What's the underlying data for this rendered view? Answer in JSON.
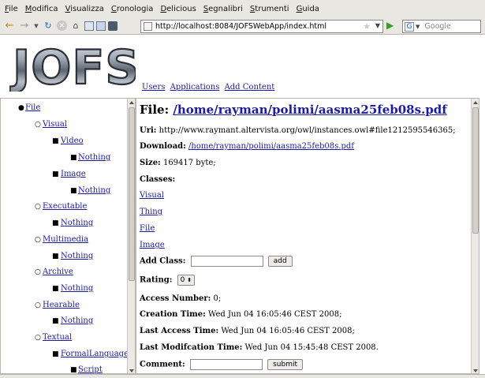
{
  "menu": [
    "File",
    "Modifica",
    "Visualizza",
    "Cronologia",
    "Delicious",
    "Segnalibri",
    "Strumenti",
    "Guida"
  ],
  "url": "http://localhost:8084/JOFSWebApp/index.html",
  "search_placeholder": "Google",
  "logo_text": "JOFS",
  "topnav": [
    "Users",
    "Applications",
    "Add Content"
  ],
  "tree": {
    "file": "File",
    "visual": "Visual",
    "video": "Video",
    "video_child": "Nothing",
    "image": "Image",
    "image_child": "Nothing",
    "executable": "Executable",
    "executable_child": "Nothing",
    "multimedia": "Multimedia",
    "multimedia_child": "Nothing",
    "archive": "Archive",
    "archive_child": "Nothing",
    "hearable": "Hearable",
    "hearable_child": "Nothing",
    "textual": "Textual",
    "formal_language": "FormalLanguage",
    "script": "Script"
  },
  "file": {
    "title_label": "File:",
    "title_path": "/home/rayman/polimi/aasma25feb08s.pdf",
    "uri_label": "Uri:",
    "uri_value": "http://www.raymant.altervista.org/owl/instances.owl#file1212595546365;",
    "download_label": "Download:",
    "download_value": "/home/rayman/polimi/aasma25feb08s.pdf",
    "size_label": "Size:",
    "size_value": "169417 byte;",
    "classes_label": "Classes:",
    "classes": [
      "Visual",
      "Thing",
      "File",
      "Image"
    ],
    "add_class_label": "Add Class:",
    "add_button": "add",
    "rating_label": "Rating:",
    "rating_value": "0",
    "access_label": "Access Number:",
    "access_value": "0;",
    "creation_label": "Creation Time:",
    "creation_value": "Wed Jun 04 16:05:46 CEST 2008;",
    "last_access_label": "Last Access Time:",
    "last_access_value": "Wed Jun 04 16:05:46 CEST 2008;",
    "last_mod_label": "Last Modifcation Time:",
    "last_mod_value": "Wed Jun 04 15:45:48 CEST 2008.",
    "comment_label": "Comment:",
    "submit_button": "submit"
  }
}
